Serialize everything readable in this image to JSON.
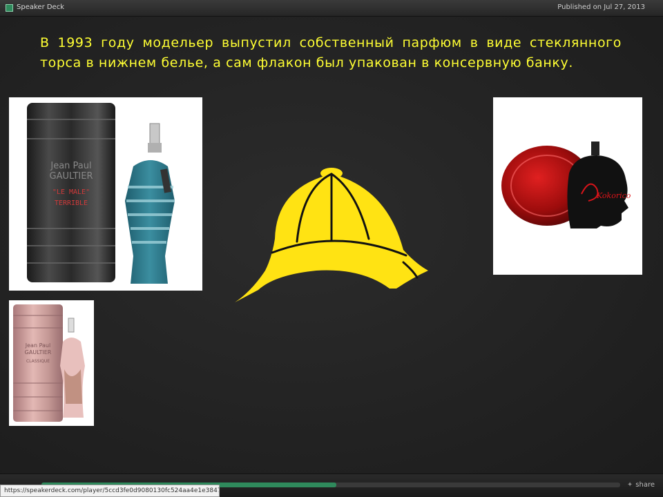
{
  "app": {
    "title": "Speaker Deck",
    "published": "Published on Jul 27, 2013",
    "accent_color": "#2f8a5c"
  },
  "slide": {
    "text": "В 1993 году модельер выпустил собственный парфюм в виде стеклянного торса в нижнем белье, а сам флакон был упакован в консервную банку.",
    "text_color": "#ffff33",
    "images": [
      {
        "name": "le-male-perfume-photo",
        "can_text_1": "Jean Paul",
        "can_text_2": "GAULTIER",
        "can_text_3": "\"LE MALE\"",
        "can_text_4": "TERRIBLE"
      },
      {
        "name": "classique-perfume-photo",
        "can_text_1": "Jean Paul",
        "can_text_2": "GAULTIER",
        "can_text_3": "CLASSIQUE"
      },
      {
        "name": "kokorico-perfume-photo",
        "bottle_text": "Kokorico"
      }
    ],
    "hat_color": "#ffe313"
  },
  "player": {
    "progress": 0.51,
    "share_label": "share",
    "share_icon": "twitter-bird-icon"
  },
  "status_url": "https://speakerdeck.com/player/5ccd3fe0d9080130fc524aa4e1e38476?#"
}
